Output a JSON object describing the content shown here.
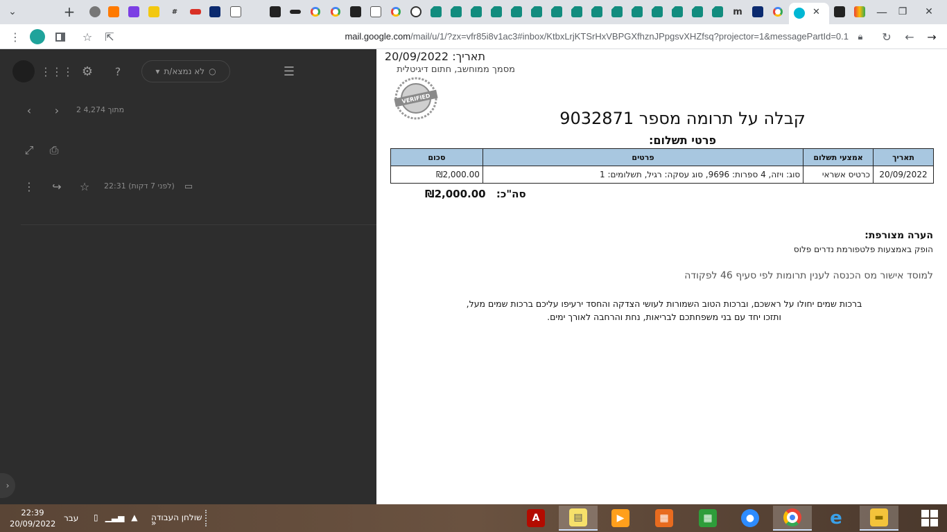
{
  "browser": {
    "url_host": "mail.google.com",
    "url_rest": "/mail/u/1/?zx=vfr85i8v1ac3#inbox/KtbxLrjKTSrHxVBPGXfhznJPpgsvXHZfsq?projector=1&messagePartId=0.1",
    "new_tab_symbol": "+",
    "tabs_menu_symbol": "⌄",
    "active_tab_close": "✕"
  },
  "gmail": {
    "status_label": "לא נמצא/ת",
    "pager_text": "2 מתוך 4,274",
    "message_time": "22:31 (לפני 7 דקות)"
  },
  "document": {
    "date_line": "תאריך: 20/09/2022",
    "signature_line": "מסמך ממוחשב, חתום דיגיטלית",
    "title": "קבלה על תרומה מספר 9032871",
    "payment_heading": "פרטי תשלום:",
    "table": {
      "headers": [
        "תאריך",
        "אמצעי תשלום",
        "פרטים",
        "סכום"
      ],
      "rows": [
        [
          "20/09/2022",
          "כרטיס אשראי",
          "סוג: ויזה, 4 ספרות: 9696, סוג עסקה: רגיל, תשלומים: 1",
          "₪2,000.00"
        ]
      ]
    },
    "total_label": "סה\"כ:",
    "total_value": "₪2,000.00",
    "note_heading": "הערה מצורפת:",
    "note_text": "הופק באמצעות פלטפורמת נדרים פלוס",
    "tax_text": "למוסד אישור מס הכנסה לענין תרומות לפי סעיף 46 לפקודה",
    "blessing_line1": "ברכות שמים יחולו על ראשכם, וברכות הטוב השמורות לעושי הצדקה והחסד ירעיפו עליכם ברכות שמים מעל,",
    "blessing_line2": "ותזכו יחד עם בני משפחתכם לבריאות, נחת והרחבה לאורך ימים."
  },
  "taskbar": {
    "time": "22:39",
    "date": "20/09/2022",
    "language": "עבר",
    "desktop_label": "שולחן העבודה",
    "desktop_chevron": "»"
  },
  "colors": {
    "table_header_bg": "#a8c7e0",
    "gmail_bg": "#2d2d2d",
    "tabstrip_bg": "#dee1e6"
  }
}
